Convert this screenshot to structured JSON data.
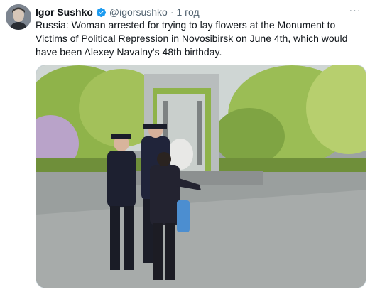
{
  "tweet": {
    "author_name": "Igor Sushko",
    "author_handle": "@igorsushko",
    "separator": "·",
    "timestamp": "1 год",
    "text": "Russia: Woman arrested for trying to lay flowers at the Monument to Victims of Political Repression in Novosibirsk on June 4th, which would have been Alexey Navalny's 48th birthday.",
    "more_label": "···"
  },
  "colors": {
    "verified_blue": "#1d9bf0",
    "secondary_text": "#536471",
    "primary_text": "#0f1419"
  }
}
